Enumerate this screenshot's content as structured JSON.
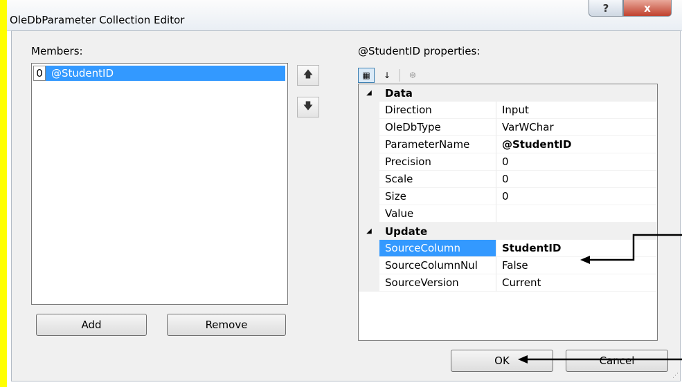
{
  "window": {
    "title": "OleDbParameter Collection Editor",
    "help_glyph": "?",
    "close_glyph": "x"
  },
  "members": {
    "label": "Members:",
    "items": [
      {
        "index": "0",
        "name": "@StudentID"
      }
    ],
    "up_icon": "arrow-up-icon",
    "down_icon": "arrow-down-icon",
    "add_label": "Add",
    "remove_label": "Remove"
  },
  "properties": {
    "label": "@StudentID properties:",
    "toolbar": {
      "categorized_icon": "categorized-icon",
      "alphabetical_icon": "alphabetical-sort-icon",
      "property_pages_icon": "wrench-icon"
    },
    "categories": [
      {
        "name": "Data",
        "rows": [
          {
            "name": "Direction",
            "value": "Input"
          },
          {
            "name": "OleDbType",
            "value": "VarWChar"
          },
          {
            "name": "ParameterName",
            "value": "@StudentID"
          },
          {
            "name": "Precision",
            "value": "0"
          },
          {
            "name": "Scale",
            "value": "0"
          },
          {
            "name": "Size",
            "value": "0"
          },
          {
            "name": "Value",
            "value": ""
          }
        ]
      },
      {
        "name": "Update",
        "rows": [
          {
            "name": "SourceColumn",
            "value": "StudentID"
          },
          {
            "name": "SourceColumnNul",
            "value": "False"
          },
          {
            "name": "SourceVersion",
            "value": "Current"
          }
        ]
      }
    ]
  },
  "footer": {
    "ok_label": "OK",
    "cancel_label": "Cancel"
  },
  "colors": {
    "selection": "#3399ff",
    "frame": "#ffff00"
  }
}
